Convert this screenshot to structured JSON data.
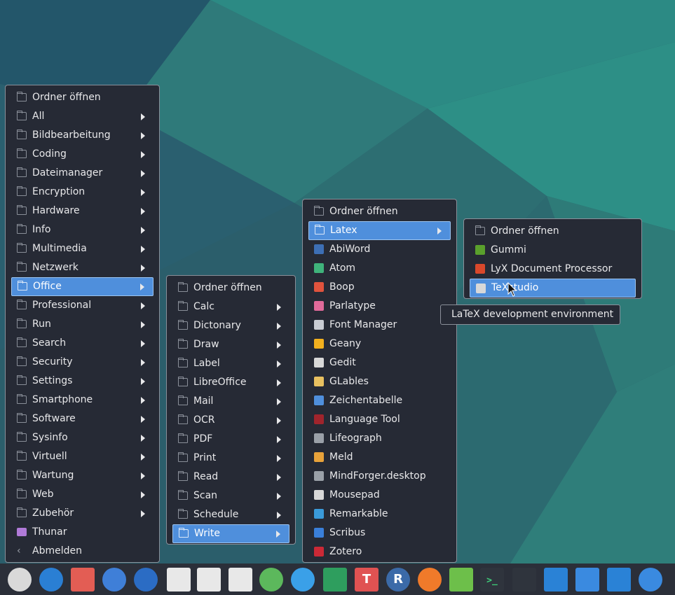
{
  "menu1": {
    "items": [
      {
        "label": "Ordner öffnen",
        "icon": "folder-icon",
        "sub": false
      },
      {
        "label": "All",
        "icon": "folder-icon",
        "sub": true
      },
      {
        "label": "Bildbearbeitung",
        "icon": "folder-icon",
        "sub": true
      },
      {
        "label": "Coding",
        "icon": "folder-icon",
        "sub": true
      },
      {
        "label": "Dateimanager",
        "icon": "folder-icon",
        "sub": true
      },
      {
        "label": "Encryption",
        "icon": "folder-icon",
        "sub": true
      },
      {
        "label": "Hardware",
        "icon": "folder-icon",
        "sub": true
      },
      {
        "label": "Info",
        "icon": "folder-icon",
        "sub": true
      },
      {
        "label": "Multimedia",
        "icon": "folder-icon",
        "sub": true
      },
      {
        "label": "Netzwerk",
        "icon": "folder-icon",
        "sub": true
      },
      {
        "label": "Office",
        "icon": "folder-icon",
        "sub": true
      },
      {
        "label": "Professional",
        "icon": "folder-icon",
        "sub": true
      },
      {
        "label": "Run",
        "icon": "folder-icon",
        "sub": true
      },
      {
        "label": "Search",
        "icon": "folder-icon",
        "sub": true
      },
      {
        "label": "Security",
        "icon": "folder-icon",
        "sub": true
      },
      {
        "label": "Settings",
        "icon": "folder-icon",
        "sub": true
      },
      {
        "label": "Smartphone",
        "icon": "folder-icon",
        "sub": true
      },
      {
        "label": "Software",
        "icon": "folder-icon",
        "sub": true
      },
      {
        "label": "Sysinfo",
        "icon": "folder-icon",
        "sub": true
      },
      {
        "label": "Virtuell",
        "icon": "folder-icon",
        "sub": true
      },
      {
        "label": "Wartung",
        "icon": "folder-icon",
        "sub": true
      },
      {
        "label": "Web",
        "icon": "folder-icon",
        "sub": true
      },
      {
        "label": "Zubehör",
        "icon": "folder-icon",
        "sub": true
      },
      {
        "label": "Thunar",
        "icon": "thunar-icon",
        "sub": false
      },
      {
        "label": "Abmelden",
        "icon": "logout-icon",
        "sub": false
      }
    ],
    "selected_index": 10
  },
  "menu2": {
    "items": [
      {
        "label": "Ordner öffnen",
        "sub": false
      },
      {
        "label": "Calc",
        "sub": true
      },
      {
        "label": "Dictonary",
        "sub": true
      },
      {
        "label": "Draw",
        "sub": true
      },
      {
        "label": "Label",
        "sub": true
      },
      {
        "label": "LibreOffice",
        "sub": true
      },
      {
        "label": "Mail",
        "sub": true
      },
      {
        "label": "OCR",
        "sub": true
      },
      {
        "label": "PDF",
        "sub": true
      },
      {
        "label": "Print",
        "sub": true
      },
      {
        "label": "Read",
        "sub": true
      },
      {
        "label": "Scan",
        "sub": true
      },
      {
        "label": "Schedule",
        "sub": true
      },
      {
        "label": "Write",
        "sub": true
      }
    ],
    "selected_index": 13
  },
  "menu3": {
    "items": [
      {
        "label": "Ordner öffnen",
        "icon": "folder-icon",
        "color": "",
        "sub": false
      },
      {
        "label": "Latex",
        "icon": "folder-icon",
        "color": "",
        "sub": true
      },
      {
        "label": "AbiWord",
        "icon": "abiword-icon",
        "color": "#3d6fb5",
        "sub": false
      },
      {
        "label": "Atom",
        "icon": "atom-icon",
        "color": "#3fb37b",
        "sub": false
      },
      {
        "label": "Boop",
        "icon": "boop-icon",
        "color": "#e0533d",
        "sub": false
      },
      {
        "label": "Parlatype",
        "icon": "parlatype-icon",
        "color": "#e06a9a",
        "sub": false
      },
      {
        "label": "Font Manager",
        "icon": "font-manager-icon",
        "color": "#c9ccd3",
        "sub": false
      },
      {
        "label": "Geany",
        "icon": "geany-icon",
        "color": "#f2b01e",
        "sub": false
      },
      {
        "label": "Gedit",
        "icon": "gedit-icon",
        "color": "#d8d8d8",
        "sub": false
      },
      {
        "label": "GLables",
        "icon": "glabels-icon",
        "color": "#e8c060",
        "sub": false
      },
      {
        "label": "Zeichentabelle",
        "icon": "charmap-icon",
        "color": "#4f8fdc",
        "sub": false
      },
      {
        "label": "Language Tool",
        "icon": "languagetool-icon",
        "color": "#a0242c",
        "sub": false
      },
      {
        "label": "Lifeograph",
        "icon": "lifeograph-icon",
        "color": "#9aa0a8",
        "sub": false
      },
      {
        "label": "Meld",
        "icon": "meld-icon",
        "color": "#e8a23a",
        "sub": false
      },
      {
        "label": "MindForger.desktop",
        "icon": "mindforger-icon",
        "color": "#9aa0a8",
        "sub": false
      },
      {
        "label": "Mousepad",
        "icon": "mousepad-icon",
        "color": "#d8d8d8",
        "sub": false
      },
      {
        "label": "Remarkable",
        "icon": "remarkable-icon",
        "color": "#3a9ad9",
        "sub": false
      },
      {
        "label": "Scribus",
        "icon": "scribus-icon",
        "color": "#3a7fd9",
        "sub": false
      },
      {
        "label": "Zotero",
        "icon": "zotero-icon",
        "color": "#cc2936",
        "sub": false
      }
    ],
    "selected_index": 1
  },
  "menu4": {
    "items": [
      {
        "label": "Ordner öffnen",
        "icon": "folder-icon",
        "color": ""
      },
      {
        "label": "Gummi",
        "icon": "gummi-icon",
        "color": "#5aa02c"
      },
      {
        "label": "LyX Document Processor",
        "icon": "lyx-icon",
        "color": "#d9482b"
      },
      {
        "label": "TeXstudio",
        "icon": "texstudio-icon",
        "color": "#d8d8d8"
      }
    ],
    "selected_index": 3
  },
  "tooltip": "LaTeX development environment",
  "taskbar": {
    "items": [
      {
        "name": "compass-icon",
        "glyph": "",
        "color": "#d9d9d9",
        "shape": "circle"
      },
      {
        "name": "hammer-icon",
        "glyph": "",
        "color": "#2a7fd4",
        "shape": "circle"
      },
      {
        "name": "mail-icon",
        "glyph": "",
        "color": "#e35d54",
        "shape": "square"
      },
      {
        "name": "network-icon",
        "glyph": "",
        "color": "#3f7fd8",
        "shape": "circle"
      },
      {
        "name": "globe-icon",
        "glyph": "",
        "color": "#2b6cc4",
        "shape": "circle"
      },
      {
        "name": "notes-icon",
        "glyph": "",
        "color": "#e8e8e8",
        "shape": "square"
      },
      {
        "name": "spreadsheet-icon",
        "glyph": "",
        "color": "#e8e8e8",
        "shape": "square"
      },
      {
        "name": "calculator-icon",
        "glyph": "",
        "color": "#e8e8e8",
        "shape": "square"
      },
      {
        "name": "key-icon",
        "glyph": "",
        "color": "#5cb85c",
        "shape": "circle"
      },
      {
        "name": "settings-tools-icon",
        "glyph": "",
        "color": "#3aa0e8",
        "shape": "circle"
      },
      {
        "name": "graduation-icon",
        "glyph": "",
        "color": "#2e9e5e",
        "shape": "square"
      },
      {
        "name": "text-editor-icon",
        "glyph": "T",
        "color": "#e05252",
        "shape": "square"
      },
      {
        "name": "r-language-icon",
        "glyph": "R",
        "color": "#3b6aa8",
        "shape": "circle"
      },
      {
        "name": "sync-icon",
        "glyph": "",
        "color": "#f07a2a",
        "shape": "circle"
      },
      {
        "name": "android-icon",
        "glyph": "",
        "color": "#6dbf4a",
        "shape": "square"
      },
      {
        "name": "terminal-icon",
        "glyph": ">_",
        "color": "#2f343d",
        "shape": "square"
      },
      {
        "name": "system-monitor-icon",
        "glyph": "",
        "color": "#2f343d",
        "shape": "square"
      },
      {
        "name": "screenshot-icon",
        "glyph": "",
        "color": "#2a82d6",
        "shape": "square"
      },
      {
        "name": "desktop-icon",
        "glyph": "",
        "color": "#3a8ae0",
        "shape": "square"
      },
      {
        "name": "split-view-icon",
        "glyph": "",
        "color": "#2a82d6",
        "shape": "square"
      },
      {
        "name": "search-icon",
        "glyph": "",
        "color": "#3a8ae0",
        "shape": "circle"
      }
    ]
  }
}
